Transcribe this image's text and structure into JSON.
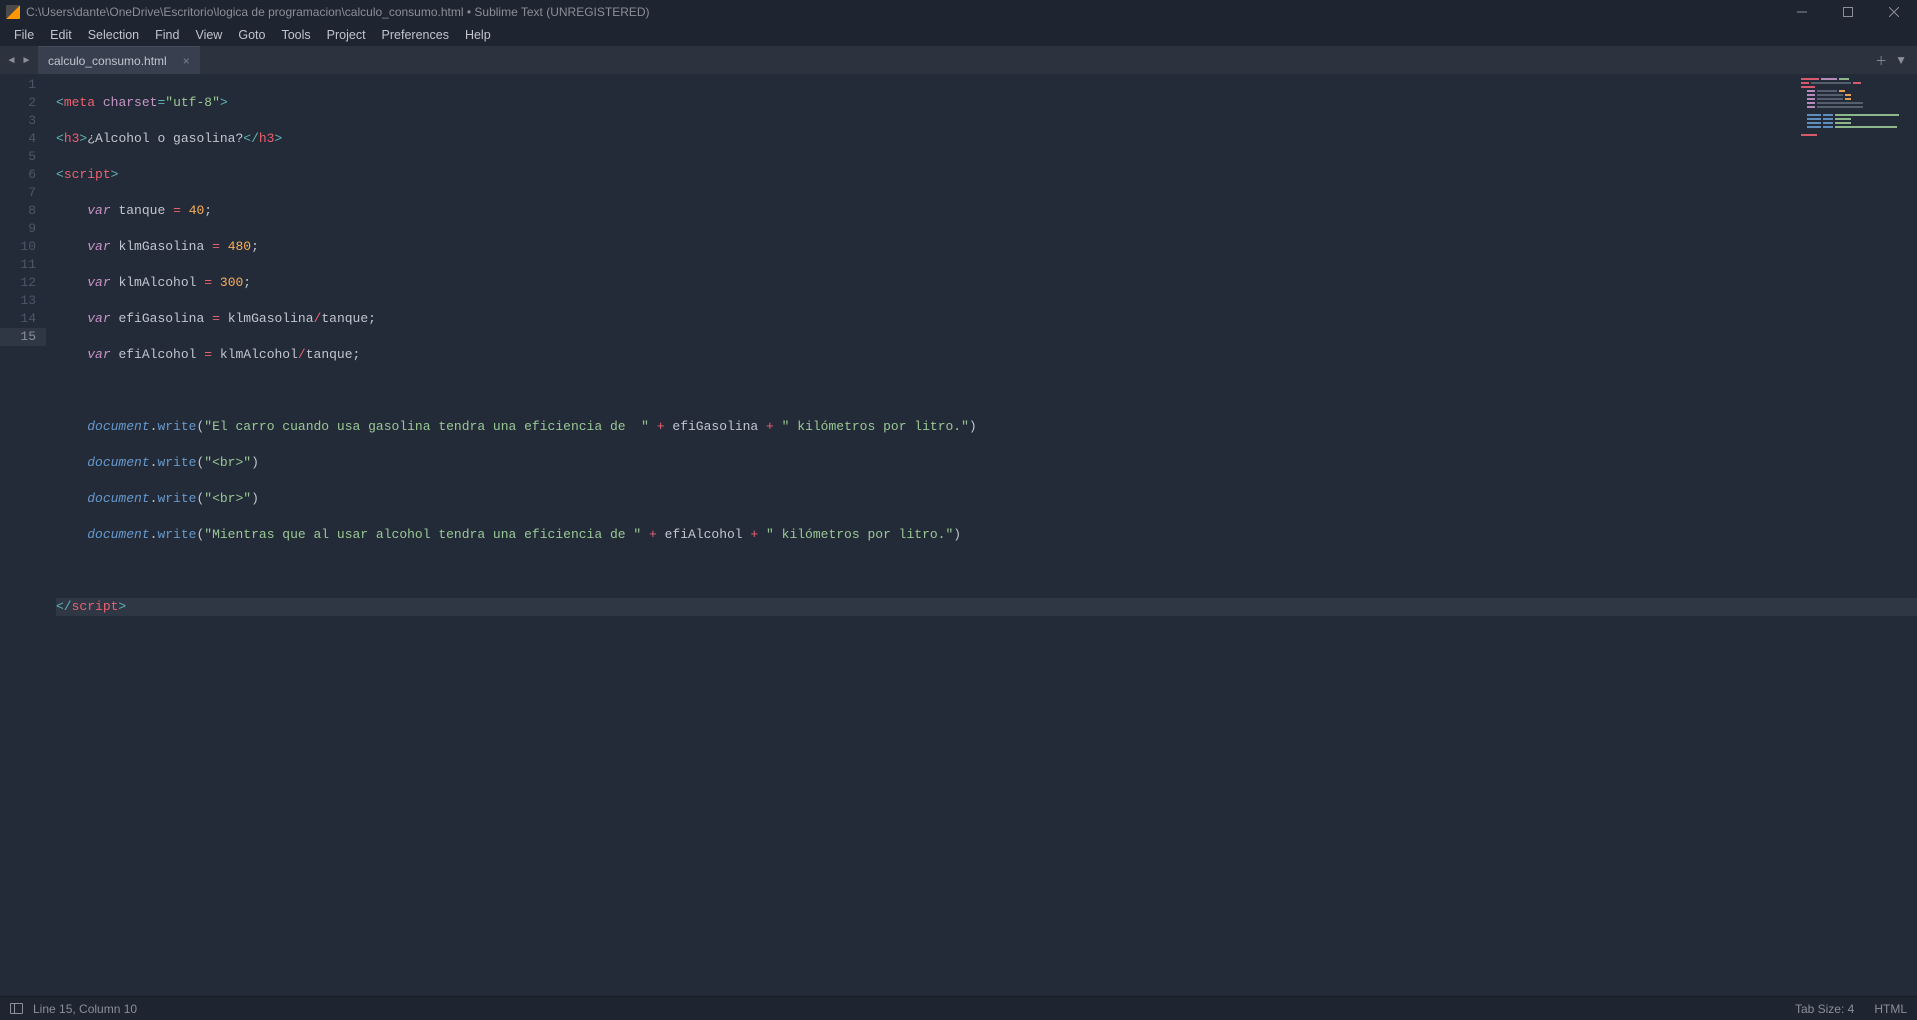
{
  "titlebar": {
    "path": "C:\\Users\\dante\\OneDrive\\Escritorio\\logica de programacion\\calculo_consumo.html • Sublime Text (UNREGISTERED)"
  },
  "menubar": [
    "File",
    "Edit",
    "Selection",
    "Find",
    "View",
    "Goto",
    "Tools",
    "Project",
    "Preferences",
    "Help"
  ],
  "tab": {
    "name": "calculo_consumo.html"
  },
  "gutter": {
    "lines": 15,
    "current": 15
  },
  "code": {
    "l1_meta_tag": "meta",
    "l1_attr": "charset",
    "l1_val": "\"utf-8\"",
    "l2_h3_open": "h3",
    "l2_content": "¿Alcohol o gasolina?",
    "l2_h3_close": "h3",
    "l3_script": "script",
    "l4_var": "var",
    "l4_name": "tanque",
    "l4_num": "40",
    "l5_var": "var",
    "l5_name": "klmGasolina",
    "l5_num": "480",
    "l6_var": "var",
    "l6_name": "klmAlcohol",
    "l6_num": "300",
    "l7_var": "var",
    "l7_name": "efiGasolina",
    "l7_rhs_a": "klmGasolina",
    "l7_rhs_b": "tanque",
    "l8_var": "var",
    "l8_name": "efiAlcohol",
    "l8_rhs_a": "klmAlcohol",
    "l8_rhs_b": "tanque",
    "doc_obj": "document",
    "write_fn": "write",
    "l10_str": "\"El carro cuando usa gasolina tendra una eficiencia de  \"",
    "l10_v": "efiGasolina",
    "l10_str2": "\" kilómetros por litro.\"",
    "l11_str": "\"<br>\"",
    "l12_str": "\"<br>\"",
    "l13_str": "\"Mientras que al usar alcohol tendra una eficiencia de \"",
    "l13_v": "efiAlcohol",
    "l13_str2": "\" kilómetros por litro.\"",
    "l15_script": "script"
  },
  "statusbar": {
    "pos": "Line 15, Column 10",
    "tab_size": "Tab Size: 4",
    "syntax": "HTML"
  }
}
